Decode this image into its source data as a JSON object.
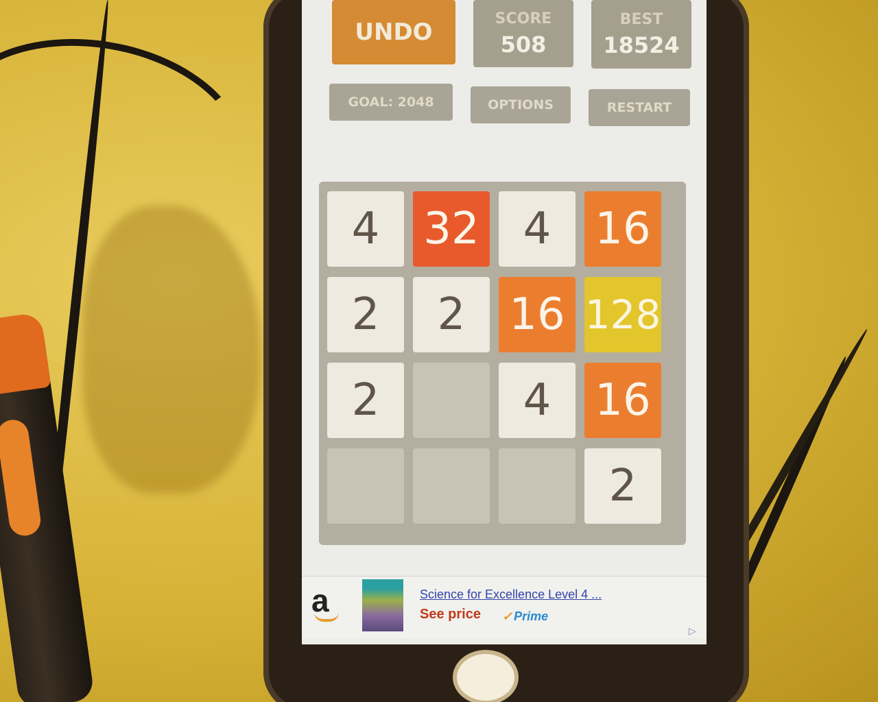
{
  "header": {
    "undo_label": "UNDO",
    "score_label": "SCORE",
    "score_value": "508",
    "best_label": "BEST",
    "best_value": "18524"
  },
  "controls": {
    "goal_label": "GOAL: 2048",
    "options_label": "OPTIONS",
    "restart_label": "RESTART"
  },
  "board": {
    "rows": 4,
    "cols": 4,
    "tiles": [
      [
        "4",
        "32",
        "4",
        "16"
      ],
      [
        "2",
        "2",
        "16",
        "128"
      ],
      [
        "2",
        "",
        "4",
        "16"
      ],
      [
        "",
        "",
        "",
        "2"
      ]
    ]
  },
  "ad": {
    "logo": "a",
    "title": "Science for Excellence Level 4 ...",
    "price_label": "See price",
    "prime_label": "Prime"
  },
  "colors": {
    "tile_16": "#eb7e2e",
    "tile_32": "#e85a2c",
    "tile_128": "#e3c52c",
    "tile_low": "#efeae0",
    "tile_empty": "#c9c3b5",
    "undo": "#d58a34"
  }
}
